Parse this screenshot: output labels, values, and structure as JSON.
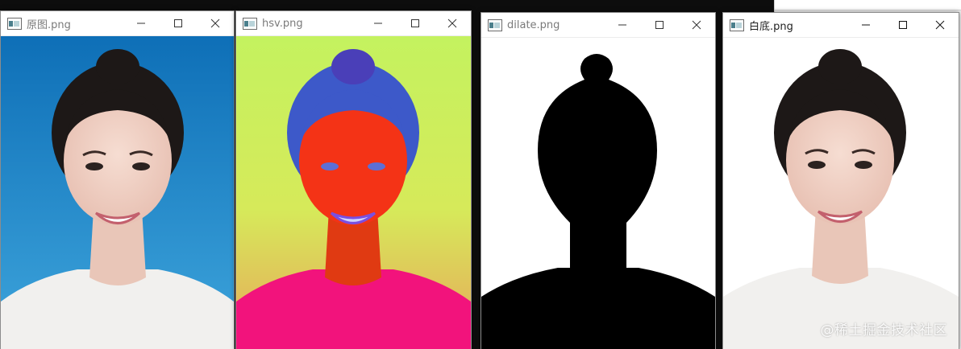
{
  "windows": [
    {
      "title": "原图.png",
      "active": false,
      "image": "original portrait, blue background"
    },
    {
      "title": "hsv.png",
      "active": false,
      "image": "hsv false-color portrait"
    },
    {
      "title": "dilate.png",
      "active": false,
      "image": "black silhouette on white"
    },
    {
      "title": "白底.png",
      "active": true,
      "image": "portrait on white background"
    }
  ],
  "controls": {
    "minimize_icon": "minimize-icon",
    "maximize_icon": "maximize-icon",
    "close_icon": "close-icon"
  },
  "watermark": "@稀土掘金技术社区",
  "colors": {
    "blue_bg_top": "#0e6fb7",
    "blue_bg_bottom": "#3ea5dc",
    "hsv_top": "#c4f25f",
    "hsv_bottom": "#e8a45a",
    "hsv_face": "#f43316",
    "hsv_shirt": "#f2137c",
    "hsv_hair": "#3d59c9",
    "hair": "#1d1817",
    "skin": "#f0d2c6",
    "shirt": "#f1f0ee",
    "silhouette": "#000000",
    "white_bg": "#ffffff"
  }
}
